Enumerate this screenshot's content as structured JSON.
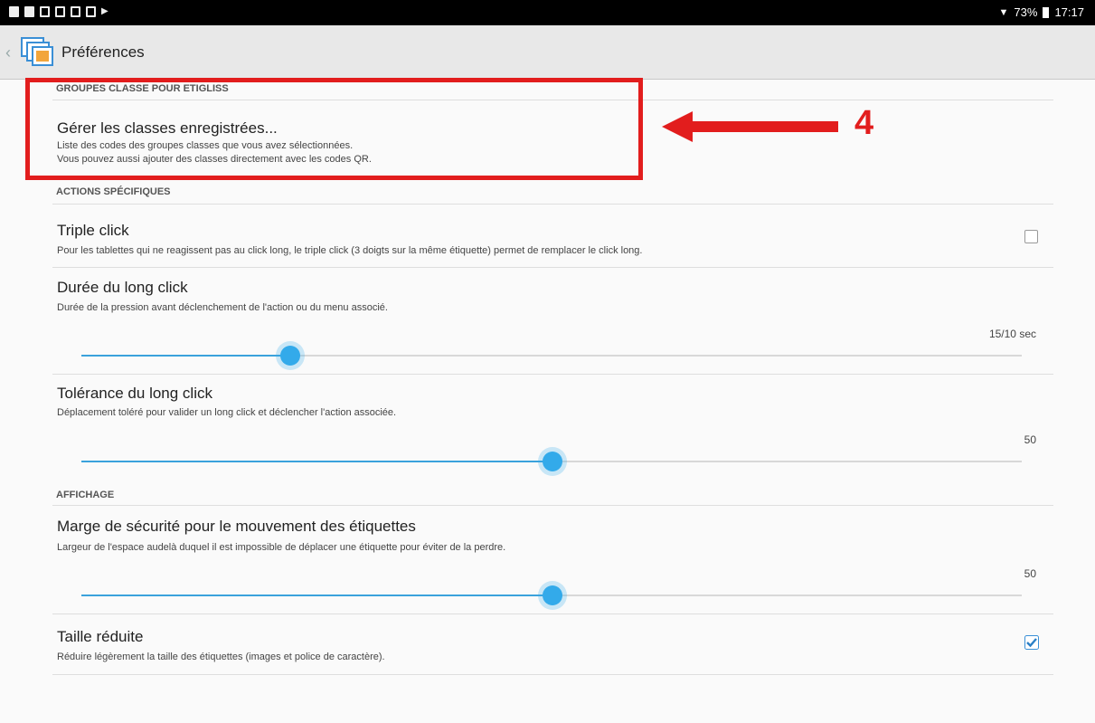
{
  "status_bar": {
    "battery": "73%",
    "time": "17:17"
  },
  "app_bar": {
    "title": "Préférences",
    "back_icon": "chevron-left-icon",
    "app_icon": "stacked-windows-icon"
  },
  "sections": {
    "groupes": {
      "header": "GROUPES CLASSE POUR ETIGLISS",
      "manage": {
        "title": "Gérer les classes enregistrées...",
        "summary_1": "Liste des codes des groupes classes que vous avez sélectionnées.",
        "summary_2": "Vous pouvez aussi ajouter des classes directement avec les codes QR."
      }
    },
    "actions": {
      "header": "ACTIONS SPÉCIFIQUES",
      "triple_click": {
        "title": "Triple click",
        "summary": "Pour les tablettes qui ne reagissent pas au click long, le triple click (3 doigts sur la même étiquette) permet de remplacer le click long.",
        "checked": false
      },
      "long_click_duration": {
        "title": "Durée du long click",
        "summary": "Durée de la pression avant déclenchement de l'action ou du menu associé.",
        "value_label": "15/10 sec",
        "fraction": 0.23
      },
      "long_click_tolerance": {
        "title": "Tolérance du long click",
        "summary": "Déplacement toléré pour valider un long click et déclencher l'action associée.",
        "value_label": "50",
        "fraction": 0.5
      }
    },
    "affichage": {
      "header": "AFFICHAGE",
      "margin": {
        "title": "Marge de sécurité pour le mouvement des étiquettes",
        "summary": "Largeur de l'espace audelà duquel il est impossible de déplacer une étiquette pour éviter de la perdre.",
        "value_label": "50",
        "fraction": 0.5
      },
      "reduced_size": {
        "title": "Taille réduite",
        "summary": "Réduire légèrement la taille des étiquettes (images et police de caractère).",
        "checked": true
      }
    }
  },
  "annotation": {
    "number": "4",
    "color": "#e21d1d"
  },
  "colors": {
    "accent": "#33aaea",
    "annotation": "#e21d1d"
  }
}
